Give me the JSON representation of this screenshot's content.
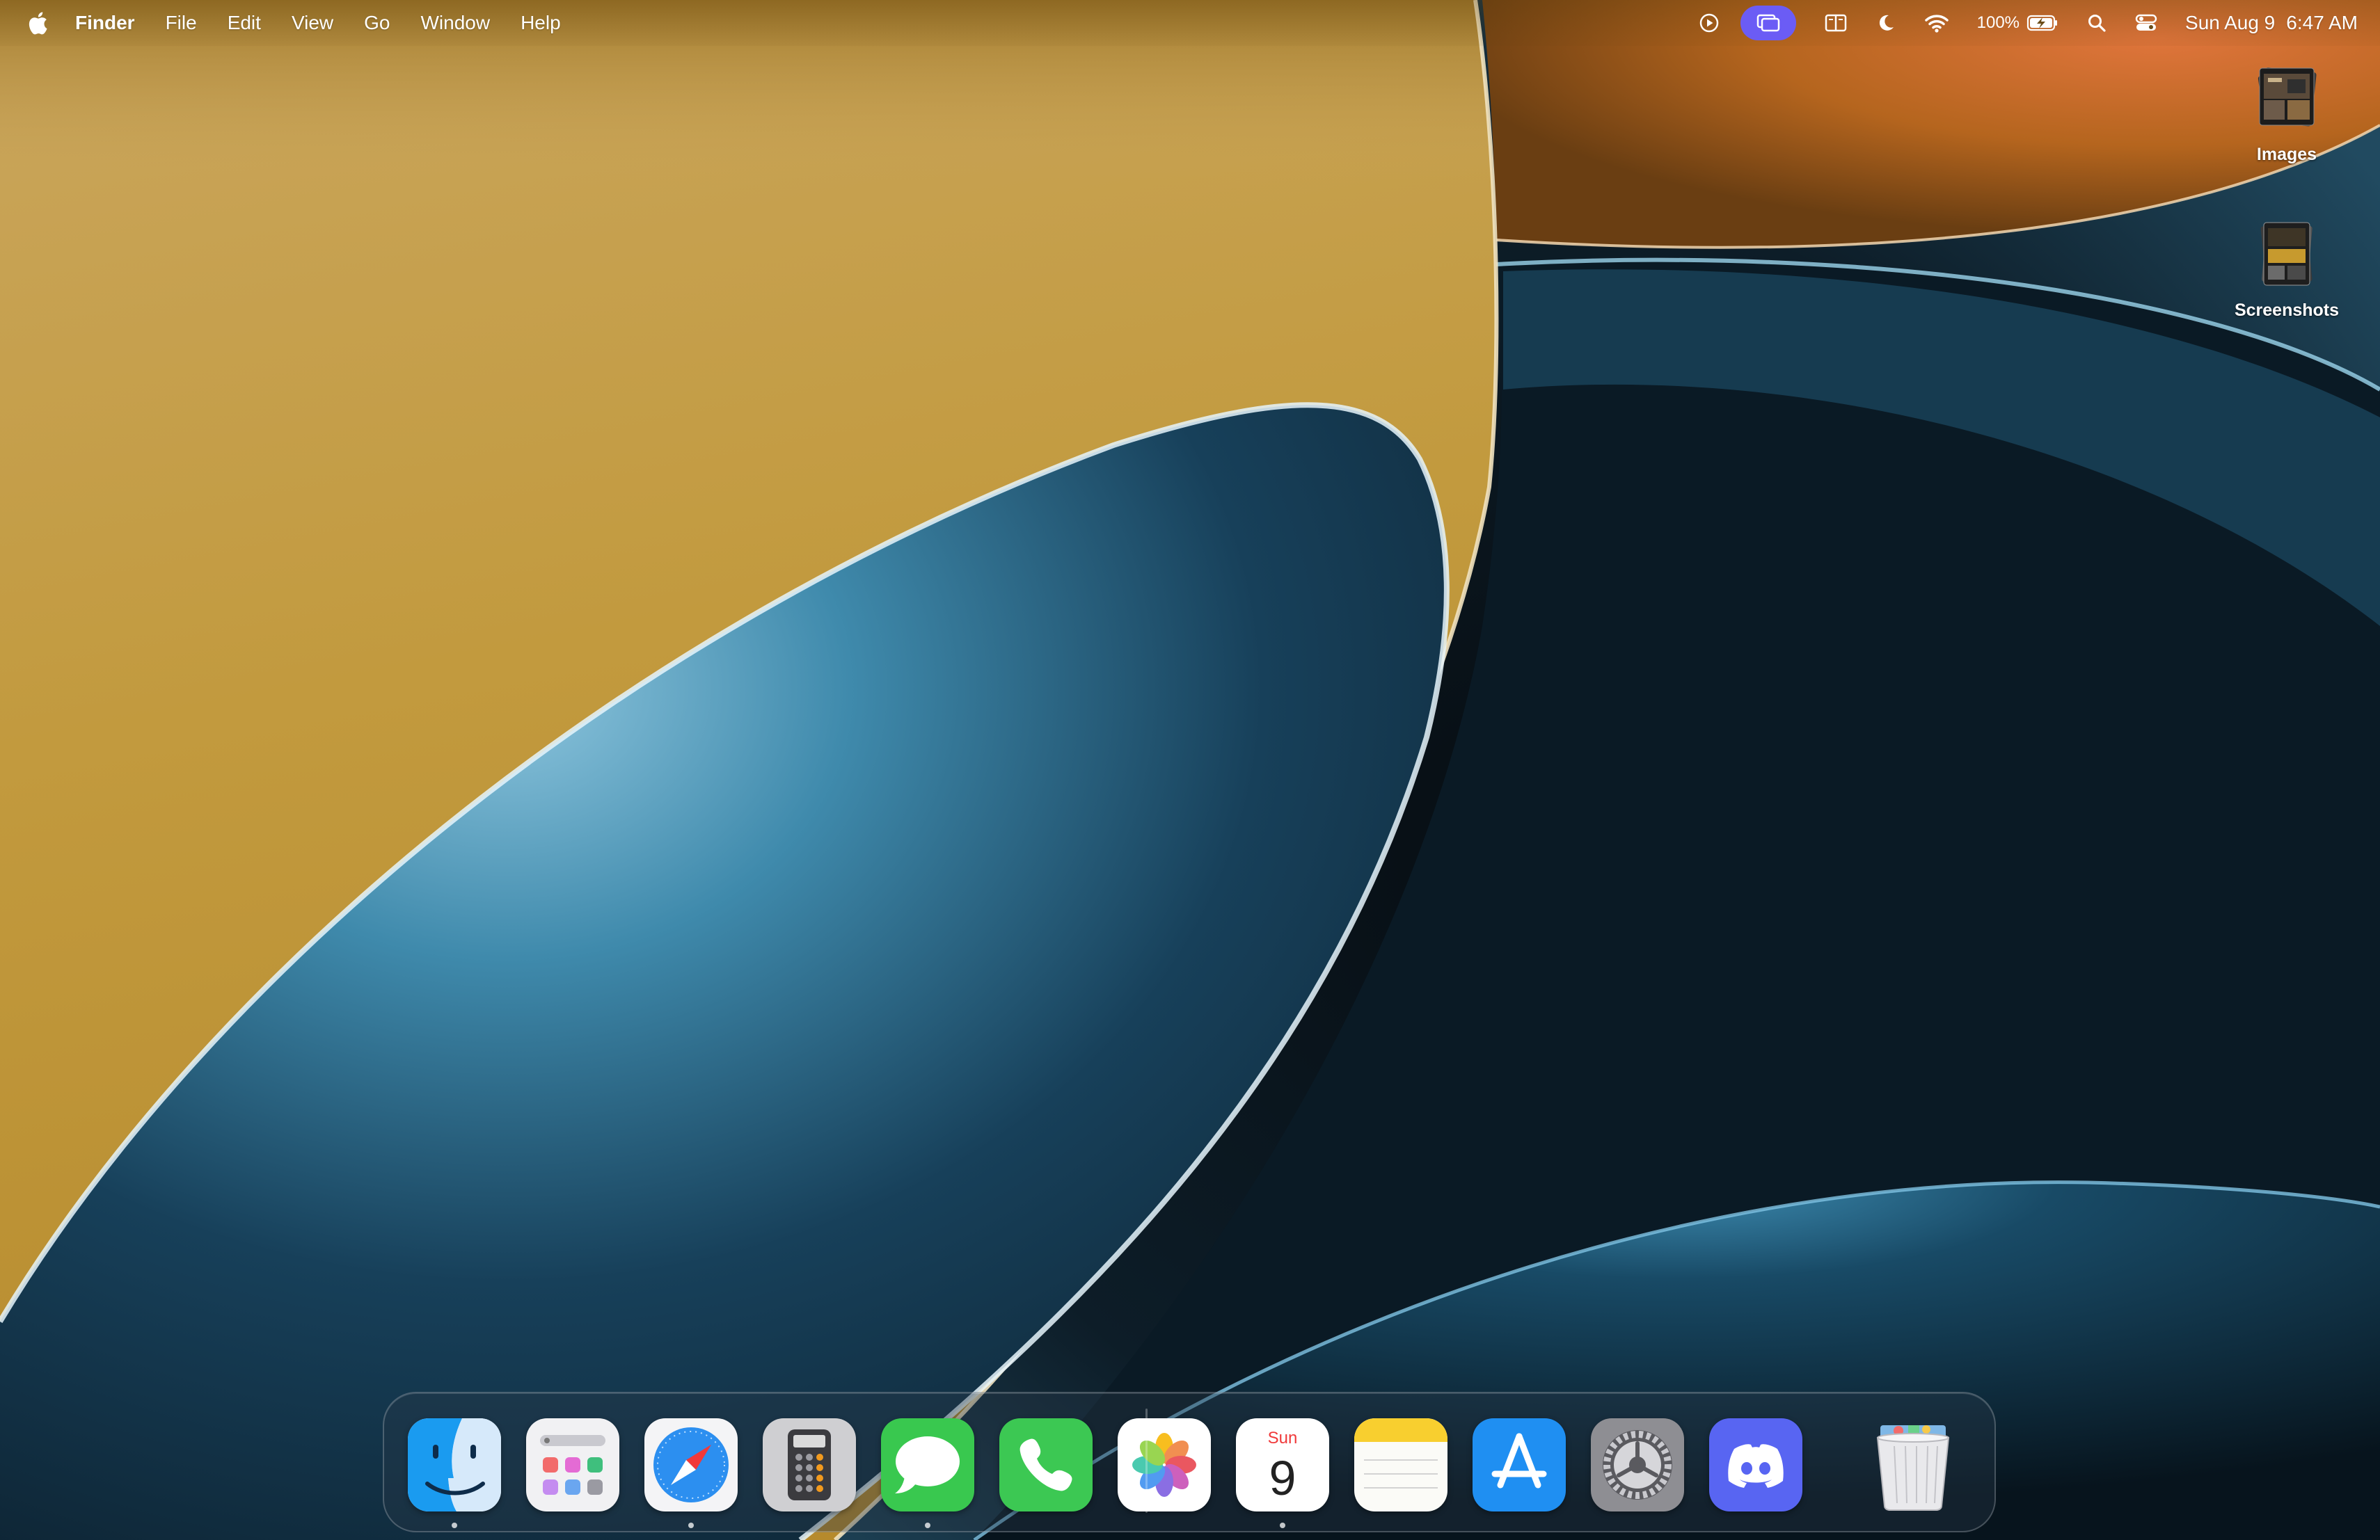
{
  "menubar": {
    "apple_icon": "apple-logo-icon",
    "app_name": "Finder",
    "menus": [
      "File",
      "Edit",
      "View",
      "Go",
      "Window",
      "Help"
    ],
    "status_icons": [
      "play-circle-icon",
      "screen-mirroring-icon",
      "split-view-icon",
      "moon-focus-icon",
      "wifi-icon"
    ],
    "battery_percent": "100%",
    "battery_icon": "battery-charging-icon",
    "search_icon": "spotlight-search-icon",
    "control_center_icon": "control-center-icon",
    "date": "Sun Aug 9",
    "time": "6:47 AM",
    "active_accent": "#6b5cf5"
  },
  "desktop": {
    "items": [
      {
        "label": "Images",
        "icon": "image-stack-folder-icon"
      },
      {
        "label": "Screenshots",
        "icon": "screenshot-stack-folder-icon"
      }
    ]
  },
  "dock": {
    "apps": [
      {
        "name": "Finder",
        "icon": "finder-icon",
        "running": true
      },
      {
        "name": "Launchpad",
        "icon": "launchpad-icon",
        "running": false
      },
      {
        "name": "Safari",
        "icon": "safari-compass-icon",
        "running": true
      },
      {
        "name": "Calculator",
        "icon": "calculator-icon",
        "running": false
      },
      {
        "name": "Messages",
        "icon": "messages-bubble-icon",
        "running": true
      },
      {
        "name": "Phone",
        "icon": "phone-handset-icon",
        "running": false
      },
      {
        "name": "Photos",
        "icon": "photos-flower-icon",
        "running": false
      },
      {
        "name": "Calendar",
        "icon": "calendar-icon",
        "running": true,
        "day_label": "Sun",
        "day_number": "9"
      },
      {
        "name": "Notes",
        "icon": "notes-icon",
        "running": false
      },
      {
        "name": "App Store",
        "icon": "app-store-icon",
        "running": false
      },
      {
        "name": "System Settings",
        "icon": "settings-gear-icon",
        "running": false
      },
      {
        "name": "Discord",
        "icon": "discord-icon",
        "running": false
      }
    ],
    "trash": {
      "name": "Trash",
      "icon": "trash-full-icon"
    }
  }
}
